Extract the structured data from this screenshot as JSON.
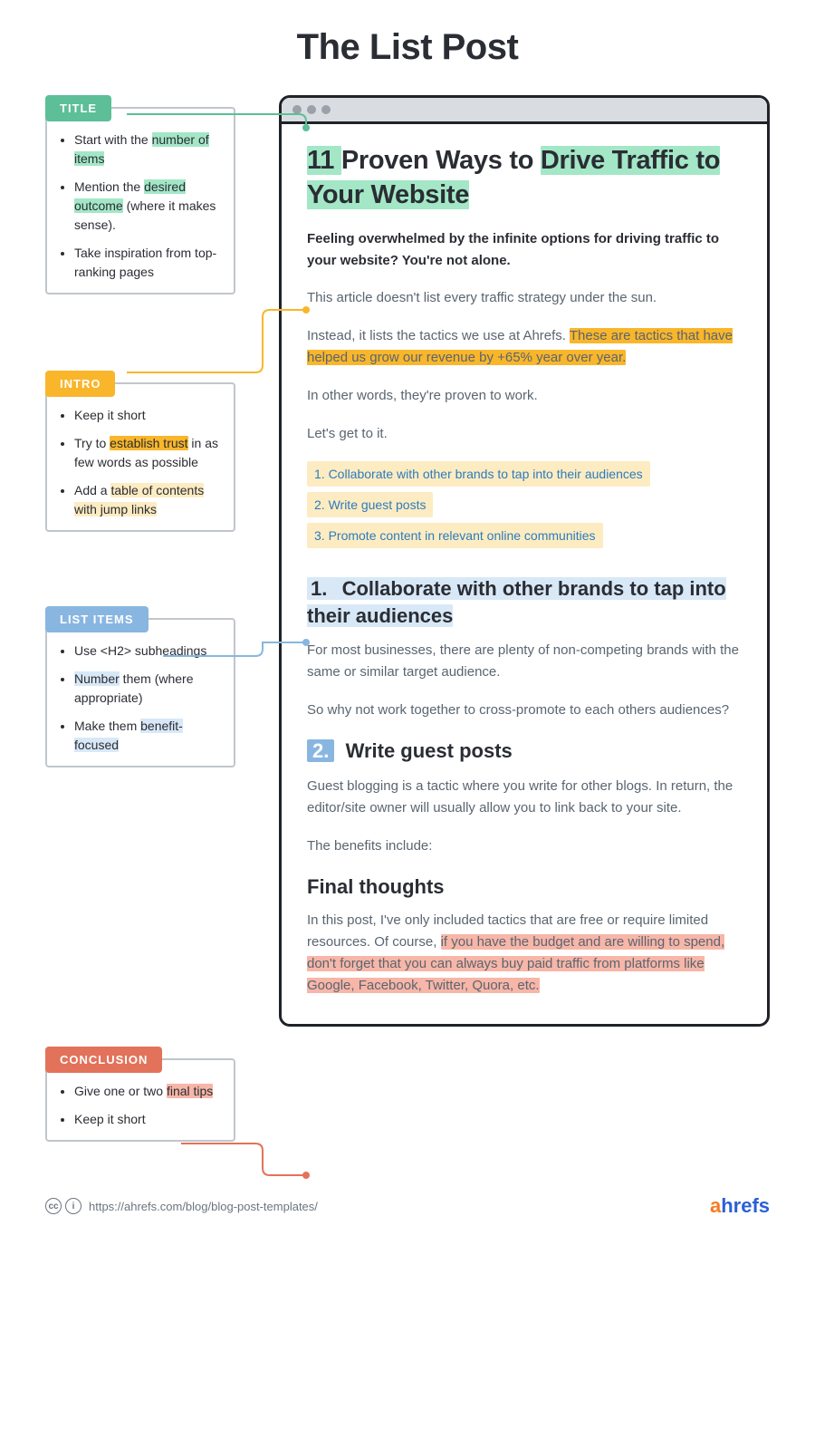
{
  "main_title": "The List Post",
  "colors": {
    "green": "#5cbf97",
    "yellow": "#f9b62b",
    "blue": "#88b6e0",
    "red": "#e3725a"
  },
  "sections": [
    {
      "key": "title",
      "label": "TITLE",
      "color": "green",
      "tips_html": "<li>Start with the <span class='hl-green'>number of items</span></li><li>Mention the <span class='hl-green'>desired outcome</span> (where it makes sense).</li><li>Take inspiration from top-ranking pages</li>"
    },
    {
      "key": "intro",
      "label": "INTRO",
      "color": "yellow",
      "tips_html": "<li>Keep it short</li><li>Try to <span class='hl-yellow-strong'>establish trust</span> in as few words as possible</li><li>Add a <span class='hl-yellow'>table of contents with jump links</span></li>"
    },
    {
      "key": "list",
      "label": "LIST ITEMS",
      "color": "blue",
      "tips_html": "<li>Use &lt;H2&gt; subheadings</li><li><span class='hl-blue'>Number</span> them (where appropriate)</li><li>Make them <span class='hl-blue'>benefit-focused</span></li>"
    },
    {
      "key": "conclusion",
      "label": "CONCLUSION",
      "color": "red",
      "tips_html": "<li>Give one or two <span class='hl-red'>final tips</span></li><li>Keep it short</li>"
    }
  ],
  "post": {
    "title_html": "<span class='hl-green'>11 </span>Proven Ways to <span class='hl-green'>Drive Traffic to Your Website</span>",
    "intro_bold": "Feeling overwhelmed by the infinite options for driving traffic to your website? You're not alone.",
    "para1": "This article doesn't list every traffic strategy under the sun.",
    "para2_html": "Instead, it lists the tactics we use at Ahrefs. <span class='hl-yellow-strong'> These are tactics that have helped us grow our revenue by +65% year over year. </span>",
    "para3": "In other words, they're proven to work.",
    "para4": "Let's get to it.",
    "toc": [
      "1. Collaborate with other brands to tap into their audiences",
      "2. Write guest posts",
      "3. Promote content in relevant online communities"
    ],
    "item1_heading_html": "<span class='hl-blue'><span class='h2-num'>1.</span>&nbsp; Collaborate with other brands to tap into their audiences</span>",
    "item1_p1": "For most businesses, there are plenty of non-competing brands with the same or similar target audience.",
    "item1_p2": "So why not work together to cross-promote to each others audiences?",
    "item2_heading_html": "<span class='h2-num-strong'>2.</span>&nbsp; Write guest posts",
    "item2_p1": "Guest blogging is a tactic where you write for other blogs. In return, the editor/site owner will usually allow you to link back to your site.",
    "item2_p2": "The benefits include:",
    "final_heading": "Final thoughts",
    "final_p_html": "In this post, I've only included tactics that are free or require limited resources. Of course, <span class='hl-red'> if you have the budget and are willing to spend, don't forget that you can always buy paid traffic from platforms like Google, Facebook, Twitter, Quora, etc. </span>"
  },
  "footer": {
    "url": "https://ahrefs.com/blog/blog-post-templates/",
    "brand": "ahrefs"
  }
}
